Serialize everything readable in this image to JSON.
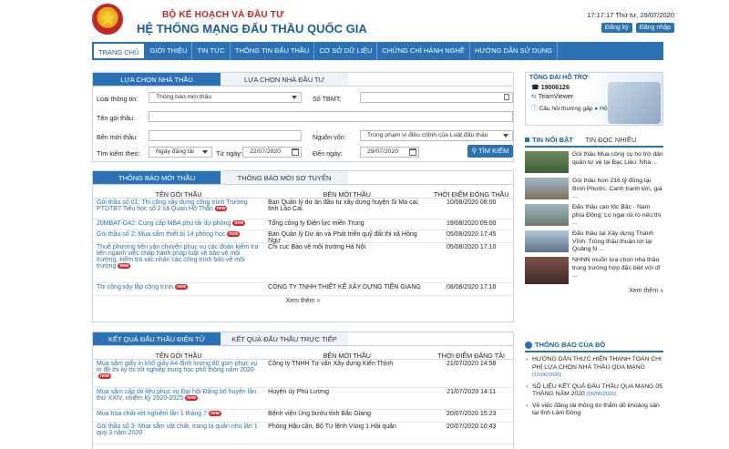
{
  "header": {
    "ministry": "BỘ KẾ HOẠCH VÀ ĐẦU TƯ",
    "system": "HỆ THỐNG MẠNG ĐẤU THẦU QUỐC GIA",
    "clock": "17:17:17 Thứ tư, 29/07/2020",
    "register": "Đăng ký",
    "login": "Đăng nhập"
  },
  "nav": [
    "TRANG CHỦ",
    "GIỚI THIỆU",
    "TIN TỨC",
    "THÔNG TIN ĐẤU THẦU",
    "CƠ SỞ DỮ LIỆU",
    "CHỨNG CHỈ HÀNH NGHỀ",
    "HƯỚNG DẪN SỬ DỤNG"
  ],
  "search": {
    "tab1": "LỰA CHỌN NHÀ THẦU",
    "tab2": "LỰA CHỌN NHÀ ĐẦU TƯ",
    "type_label": "Loại thông tin:",
    "type_value": "Thông báo mời thầu",
    "tbmt_label": "Số TBMT:",
    "package_label": "Tên gói thầu:",
    "inviter_label": "Bên mời thầu:",
    "capital_label": "Nguồn vốn:",
    "capital_value": "Trong phạm vi điều chỉnh của Luật đấu thầu",
    "searchby_label": "Tìm kiếm theo:",
    "searchby_value": "Ngày đăng tải",
    "from_label": "Từ ngày:",
    "from_value": "22/07/2020",
    "to_label": "Đến ngày:",
    "to_value": "29/07/2020",
    "button": "TÌM KIẾM"
  },
  "bids": {
    "tab1": "THÔNG BÁO MỜI THẦU",
    "tab2": "THÔNG BÁO MỜI SƠ TUYỂN",
    "headers": [
      "TÊN GÓI THẦU",
      "BÊN MỜI THẦU",
      "THỜI ĐIỂM ĐÓNG THẦU"
    ],
    "rows": [
      {
        "name": "Gói thầu số 01: Thi công xây dựng công trình Trường PTDTBT Tiểu học số 2 xã Quan Hồ Thẩn",
        "org": "Ban Quản lý dự án đầu tư xây dựng huyện Si Ma cai, tỉnh Lào Cai.",
        "time": "10/08/2020 08:00"
      },
      {
        "name": "20MBAT-G42: Cung cấp MBA phụ tải dự phòng",
        "org": "Tổng công ty Điện lực miền Trung",
        "time": "19/08/2020 09:00"
      },
      {
        "name": "Gói thầu số 2: Mua sắm thiết bị 14 phòng học",
        "org": "Ban Quản lý Dự án và Phát triển quỹ đất thị xã Hồng Ngự",
        "time": "05/08/2020 17:45"
      },
      {
        "name": "Thuê phương tiện vận chuyển phục vụ các đoàn kiểm tra liên ngành việc chấp hành pháp luật về bảo vệ môi trường, kiểm tra xác nhận các công trình bảo vệ môi trường",
        "org": "Chi cục Bảo vệ môi trường Hà Nội",
        "time": "05/08/2020 17:10"
      },
      {
        "name": "Thi công xây lắp công trình",
        "org": "CÔNG TY TNHH THIẾT KẾ XÂY DỰNG TIẾN GIANG",
        "time": "08/08/2020 17:10"
      }
    ],
    "more": "Xem thêm »"
  },
  "results": {
    "tab1": "KẾT QUẢ ĐẤU THẦU ĐIỆN TỬ",
    "tab2": "KẾT QUẢ ĐẤU THẦU TRỰC TIẾP",
    "headers": [
      "TÊN GÓI THẦU",
      "BÊN MỜI THẦU",
      "THỜI ĐIỂM ĐĂNG TẢI"
    ],
    "rows": [
      {
        "name": "Mua sắm giấy in khổ giấy A4 định lượng 80 gsm phục vụ in đề thi kỳ thi tốt nghiệp trung học phổ thông năm 2020",
        "org": "Công ty TNHH Tư vấn Xây dựng Kiến Thịnh",
        "time": "21/07/2020 14:58"
      },
      {
        "name": "Mua sắm cấp tài liệu phục vụ Đại hội Đảng bộ huyện lần thứ XXIV, nhiệm kỳ 2020-2025",
        "org": "Huyện ủy Phú Lương",
        "time": "21/07/2020 14:11"
      },
      {
        "name": "Mua hóa chất xét nghiệm lần 1 tháng 7",
        "org": "Bệnh viện Ung bướu tỉnh Bắc Giang",
        "time": "20/07/2020 15:23"
      },
      {
        "name": "Gói thầu số 3- Mua sắm vật chất, trang bị quân nhu lần 1 quý 3 năm 2020",
        "org": "Phòng Hậu cần, Bộ Tư lệnh Vùng 1 Hải quân",
        "time": "20/07/2020 10:43"
      }
    ]
  },
  "support": {
    "title": "TỔNG ĐÀI HỖ TRỢ",
    "phone": "19006126",
    "teamviewer": "TeamViewer",
    "faq": "Câu hỏi thường gặp",
    "qa": "Hỏi & đáp"
  },
  "news": {
    "tab1": "TIN NỔI BẬT",
    "tab2": "TIN ĐỌC NHIỀU",
    "items": [
      "Gói thầu Mua công cụ hỗ trợ dân quân tự vệ tại Bạc Liêu: Nhà ...",
      "Gói thầu hơn 216 tỷ đồng tại Bình Phước: Canh tranh lớn, giá ...",
      "Đấu thầu cao tốc Bắc - Nam phía Đông: Lo ngại rủi ro nếu thi ...",
      "Đấu thầu tại Xây dựng Thanh Vĩnh: Trúng thầu thuận lợi tại Quảng N ...",
      "NHNN muốn lựa chọn nhà thầu trong trường hợp đặc biệt với dĩ ..."
    ],
    "more": "Xem thêm »"
  },
  "notices": {
    "title": "THÔNG BÁO CỦA BỘ",
    "items": [
      {
        "text": "HƯỚNG DẪN THỰC HIỆN THANH TOÁN CHI PHÍ LỰA CHỌN NHÀ THẦU QUA MẠNG",
        "date": "(11/06/2020)"
      },
      {
        "text": "SỐ LIỆU KẾT QUẢ ĐẤU THẦU QUA MẠNG 05 THÁNG NĂM 2020",
        "date": "(05/06/2020)"
      },
      {
        "text": "Về việc đăng tải thông tin thẩm dõ khoảng sản tại tỉnh Lâm Đồng",
        "date": ""
      }
    ]
  },
  "colors": {
    "primary": "#2a72b5",
    "brand_red": "#c0262c",
    "link": "#2a6fb0"
  }
}
